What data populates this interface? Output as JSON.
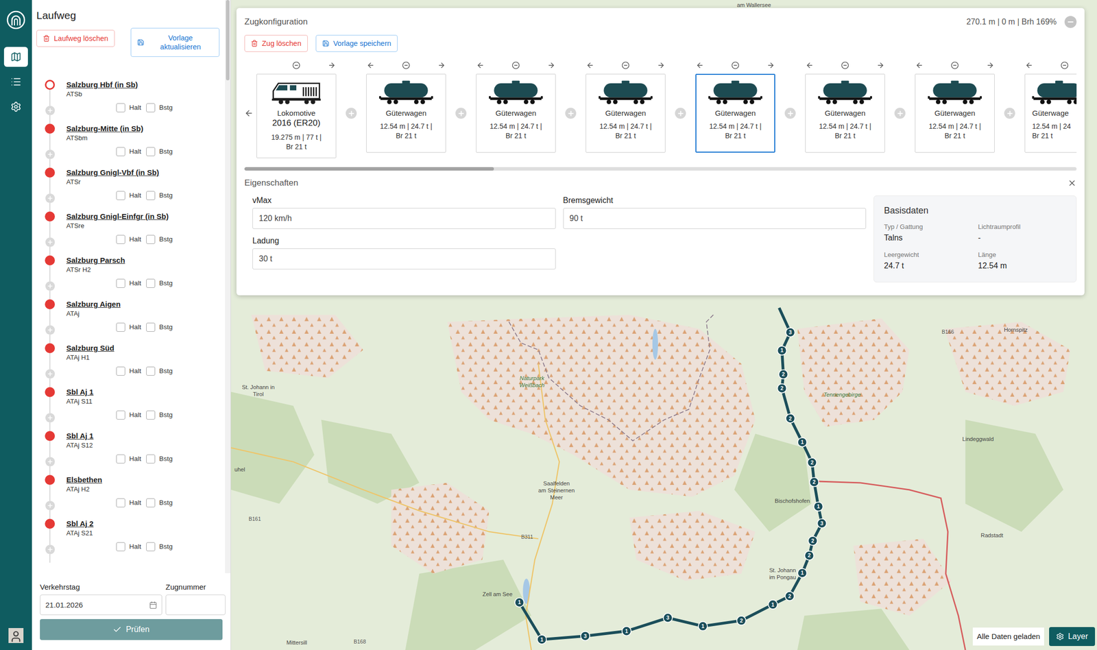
{
  "rail": {
    "items": [
      {
        "selected": true
      },
      {
        "selected": false
      },
      {
        "selected": false
      }
    ]
  },
  "sidebar": {
    "title": "Laufweg",
    "buttons": [
      {
        "label": "Laufweg löschen",
        "kind": "danger"
      },
      {
        "label": "Vorlage aktualisieren",
        "kind": "primary"
      }
    ],
    "stations": [
      {
        "name": "Salzburg Hbf (in Sb)",
        "code": "ATSb",
        "kind": "origin",
        "checks": [
          {
            "label": "Halt",
            "checked": false
          },
          {
            "label": "Bstg",
            "checked": false
          }
        ]
      },
      {
        "name": "Salzburg-Mitte (in Sb)",
        "code": "ATSbm",
        "kind": "stop",
        "checks": [
          {
            "label": "Halt",
            "checked": false
          },
          {
            "label": "Bstg",
            "checked": false
          }
        ]
      },
      {
        "name": "Salzburg Gnigl-Vbf (in Sb)",
        "code": "ATSr",
        "kind": "stop",
        "checks": [
          {
            "label": "Halt",
            "checked": false
          },
          {
            "label": "Bstg",
            "checked": false
          }
        ]
      },
      {
        "name": "Salzburg Gnigl-Einfgr (in Sb)",
        "code": "ATSre",
        "kind": "stop",
        "checks": [
          {
            "label": "Halt",
            "checked": false
          },
          {
            "label": "Bstg",
            "checked": false
          }
        ]
      },
      {
        "name": "Salzburg Parsch",
        "code": "ATSr H2",
        "kind": "stop",
        "checks": [
          {
            "label": "Halt",
            "checked": false
          },
          {
            "label": "Bstg",
            "checked": false
          }
        ]
      },
      {
        "name": "Salzburg Aigen",
        "code": "ATAj",
        "kind": "stop",
        "checks": [
          {
            "label": "Halt",
            "checked": false
          },
          {
            "label": "Bstg",
            "checked": false
          }
        ]
      },
      {
        "name": "Salzburg Süd",
        "code": "ATAj H1",
        "kind": "stop",
        "checks": [
          {
            "label": "Halt",
            "checked": false
          },
          {
            "label": "Bstg",
            "checked": false
          }
        ]
      },
      {
        "name": "Sbl Aj 1",
        "code": "ATAj S11",
        "kind": "stop",
        "checks": [
          {
            "label": "Halt",
            "checked": false
          },
          {
            "label": "Bstg",
            "checked": false
          }
        ]
      },
      {
        "name": "Sbl Aj 1",
        "code": "ATAj S12",
        "kind": "stop",
        "checks": [
          {
            "label": "Halt",
            "checked": false
          },
          {
            "label": "Bstg",
            "checked": false
          }
        ]
      },
      {
        "name": "Elsbethen",
        "code": "ATAj H2",
        "kind": "stop",
        "checks": [
          {
            "label": "Halt",
            "checked": false
          },
          {
            "label": "Bstg",
            "checked": false
          }
        ]
      },
      {
        "name": "Sbl Aj 2",
        "code": "ATAj S21",
        "kind": "stop",
        "checks": [
          {
            "label": "Halt",
            "checked": false
          },
          {
            "label": "Bstg",
            "checked": false
          }
        ]
      }
    ],
    "scroll": {
      "level": 0.14
    },
    "form": {
      "date_label": "Verkehrstag",
      "date_value": "21.01.2026",
      "number_label": "Zugnummer",
      "number_value": "",
      "submit": "Prüfen",
      "submit_disabled": true
    }
  },
  "train": {
    "title": "Zugkonfiguration",
    "summary": "270.1 m | 0 m | Brh 169%",
    "buttons": [
      {
        "label": "Zug löschen",
        "kind": "danger"
      },
      {
        "label": "Vorlage speichern",
        "kind": "primary"
      }
    ],
    "vehicles": [
      {
        "kind": "locomotive",
        "name": "Lokomotive",
        "model": "2016 (ER20)",
        "details": [
          "19.275 m | 77 t |",
          "Br 21 t"
        ],
        "selected": false,
        "move_left": false,
        "move_right": true
      },
      {
        "kind": "wagon",
        "name": "Güterwagen",
        "details": [
          "12.54 m | 24.7 t |",
          "Br 21 t"
        ],
        "selected": false,
        "move_left": true,
        "move_right": true
      },
      {
        "kind": "wagon",
        "name": "Güterwagen",
        "details": [
          "12.54 m | 24.7 t |",
          "Br 21 t"
        ],
        "selected": false,
        "move_left": true,
        "move_right": true
      },
      {
        "kind": "wagon",
        "name": "Güterwagen",
        "details": [
          "12.54 m | 24.7 t |",
          "Br 21 t"
        ],
        "selected": false,
        "move_left": true,
        "move_right": true
      },
      {
        "kind": "wagon",
        "name": "Güterwagen",
        "details": [
          "12.54 m | 24.7 t |",
          "Br 21 t"
        ],
        "selected": true,
        "move_left": true,
        "move_right": true
      },
      {
        "kind": "wagon",
        "name": "Güterwagen",
        "details": [
          "12.54 m | 24.7 t |",
          "Br 21 t"
        ],
        "selected": false,
        "move_left": true,
        "move_right": true
      },
      {
        "kind": "wagon",
        "name": "Güterwagen",
        "details": [
          "12.54 m | 24.7 t |",
          "Br 21 t"
        ],
        "selected": false,
        "move_left": true,
        "move_right": true
      },
      {
        "kind": "wagon",
        "name": "Güterwage",
        "details": [
          "12.54 m | 24",
          "Br 21 t"
        ],
        "selected": false,
        "move_left": true,
        "move_right": false
      }
    ],
    "scroll": {
      "level": 0.3
    }
  },
  "properties": {
    "title": "Eigenschaften",
    "fields": [
      {
        "label": "vMax",
        "value": "120 km/h"
      },
      {
        "label": "Bremsgewicht",
        "value": "90 t"
      },
      {
        "label": "Ladung",
        "value": "30 t"
      }
    ],
    "basis": {
      "title": "Basisdaten",
      "items": [
        {
          "label": "Typ / Gattung",
          "value": "Talns"
        },
        {
          "label": "Lichtraumprofil",
          "value": "-"
        },
        {
          "label": "Leergewicht",
          "value": "24.7 t"
        },
        {
          "label": "Länge",
          "value": "12.54 m"
        }
      ]
    }
  },
  "map": {
    "labels": [
      {
        "lines": [
          "am Wallersee"
        ],
        "kind": "place"
      },
      {
        "lines": [
          "St. Johann in",
          "Tirol"
        ],
        "kind": "place"
      },
      {
        "lines": [
          "Naturpark",
          "Weißbach"
        ],
        "kind": "nature"
      },
      {
        "lines": [
          "Tennengebirge"
        ],
        "kind": "nature"
      },
      {
        "lines": [
          "Hornspitz"
        ],
        "kind": "place"
      },
      {
        "lines": [
          "Lindeggwald"
        ],
        "kind": "place"
      },
      {
        "lines": [
          "Saalfelden",
          "am Steinernen",
          "Meer"
        ],
        "kind": "place"
      },
      {
        "lines": [
          "Bischofshofen"
        ],
        "kind": "place"
      },
      {
        "lines": [
          "Radstadt"
        ],
        "kind": "place"
      },
      {
        "lines": [
          "St. Johann",
          "im Pongau"
        ],
        "kind": "place"
      },
      {
        "lines": [
          "Zell am See"
        ],
        "kind": "place"
      },
      {
        "lines": [
          "Mittersill"
        ],
        "kind": "place"
      },
      {
        "lines": [
          "uhel"
        ],
        "kind": "place"
      }
    ],
    "roads": [
      "B166",
      "B161",
      "B311",
      "B168"
    ],
    "route": [
      "3",
      "1",
      "2",
      "2",
      "2",
      "1",
      "2",
      "2",
      "1",
      "3",
      "2",
      "2",
      "1",
      "2",
      "1",
      "2",
      "1",
      "3",
      "1",
      "3",
      "1",
      "1"
    ]
  },
  "status": {
    "text": "Alle Daten geladen",
    "layer_button": "Layer"
  }
}
